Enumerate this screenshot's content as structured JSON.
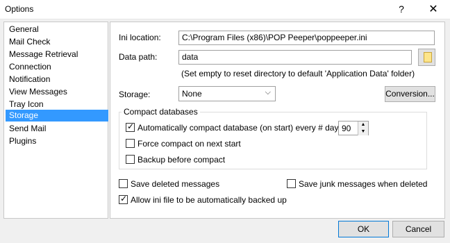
{
  "window": {
    "title": "Options",
    "help_glyph": "?",
    "close_glyph": "✕"
  },
  "nav": {
    "items": [
      {
        "label": "General"
      },
      {
        "label": "Mail Check"
      },
      {
        "label": "Message Retrieval"
      },
      {
        "label": "Connection"
      },
      {
        "label": "Notification"
      },
      {
        "label": "View Messages"
      },
      {
        "label": "Tray Icon"
      },
      {
        "label": "Storage",
        "selected": true
      },
      {
        "label": "Send Mail"
      },
      {
        "label": "Plugins"
      }
    ]
  },
  "storage": {
    "ini_location_label": "Ini location:",
    "ini_location_value": "C:\\Program Files (x86)\\POP Peeper\\poppeeper.ini",
    "data_path_label": "Data path:",
    "data_path_value": "data",
    "data_path_hint": "(Set empty to reset directory to default 'Application Data' folder)",
    "storage_label": "Storage:",
    "storage_value": "None",
    "conversion_button": "Conversion...",
    "compact_group_title": "Compact databases",
    "auto_compact_label": "Automatically compact database (on start) every # days:",
    "auto_compact_checked": true,
    "auto_compact_days": "90",
    "force_compact_label": "Force compact on next start",
    "force_compact_checked": false,
    "backup_compact_label": "Backup before compact",
    "backup_compact_checked": false,
    "save_deleted_label": "Save deleted messages",
    "save_deleted_checked": false,
    "save_junk_label": "Save junk messages when deleted",
    "save_junk_checked": false,
    "allow_backup_label": "Allow ini file to be automatically backed up",
    "allow_backup_checked": true
  },
  "footer": {
    "ok_label": "OK",
    "cancel_label": "Cancel"
  },
  "icons": {
    "checkmark": "✓",
    "dropdown": "⌵",
    "spin_up": "▲",
    "spin_down": "▼"
  },
  "colors": {
    "selection": "#3399ff",
    "default_button_border": "#0078d7"
  }
}
